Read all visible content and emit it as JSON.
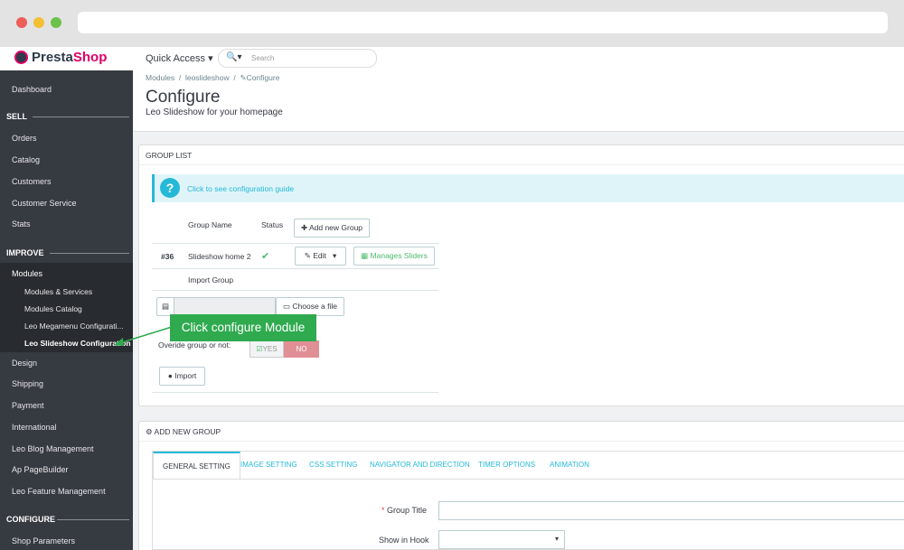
{
  "browser": {},
  "logo": {
    "text_a": "Presta",
    "text_b": "Shop"
  },
  "sidebar": {
    "dashboard": "Dashboard",
    "sell": "SELL",
    "sell_items": [
      "Orders",
      "Catalog",
      "Customers",
      "Customer Service",
      "Stats"
    ],
    "improve": "IMPROVE",
    "modules": "Modules",
    "modules_sub": [
      "Modules & Services",
      "Modules Catalog",
      "Leo Megamenu Configurati...",
      "Leo Slideshow Configuration"
    ],
    "improve_items": [
      "Design",
      "Shipping",
      "Payment",
      "International",
      "Leo Blog Management",
      "Ap PageBuilder",
      "Leo Feature Management"
    ],
    "configure": "CONFIGURE",
    "configure_items": [
      "Shop Parameters"
    ]
  },
  "topbar": {
    "quick_access": "Quick Access ▾",
    "search_icon": "🔍▾",
    "search_placeholder": "Search"
  },
  "header": {
    "breadcrumb": [
      "Modules",
      "leoslideshow",
      "Configure"
    ],
    "title": "Configure",
    "subtitle": "Leo Slideshow for your homepage"
  },
  "group_list": {
    "heading": "GROUP LIST",
    "guide_link": "Click to see configuration guide",
    "col_group_name": "Group Name",
    "col_status": "Status",
    "add_button": "Add new Group",
    "row": {
      "id": "#36",
      "name": "Slideshow home 2",
      "status_icon": "✔",
      "edit": "Edit",
      "manage": "Manages Sliders"
    },
    "import_group": "Import Group",
    "choose_file": "Choose a file",
    "override_label": "Overide group or not:",
    "yes": "YES",
    "no": "NO",
    "import_button": "Import"
  },
  "callout": {
    "text": "Click configure Module"
  },
  "add_group": {
    "heading": "ADD NEW GROUP",
    "tabs": [
      "GENERAL SETTING",
      "IMAGE SETTING",
      "CSS SETTING",
      "NAVIGATOR AND DIRECTION",
      "TIMER OPTIONS",
      "ANIMATION"
    ],
    "group_title_label": "Group Title",
    "required_mark": "*",
    "show_in_hook_label": "Show in Hook"
  },
  "colors": {
    "accent": "#25b9d7",
    "brand": "#df0067",
    "sidebar": "#363a41",
    "callout": "#2faa4f",
    "no_button": "#e08f95"
  }
}
